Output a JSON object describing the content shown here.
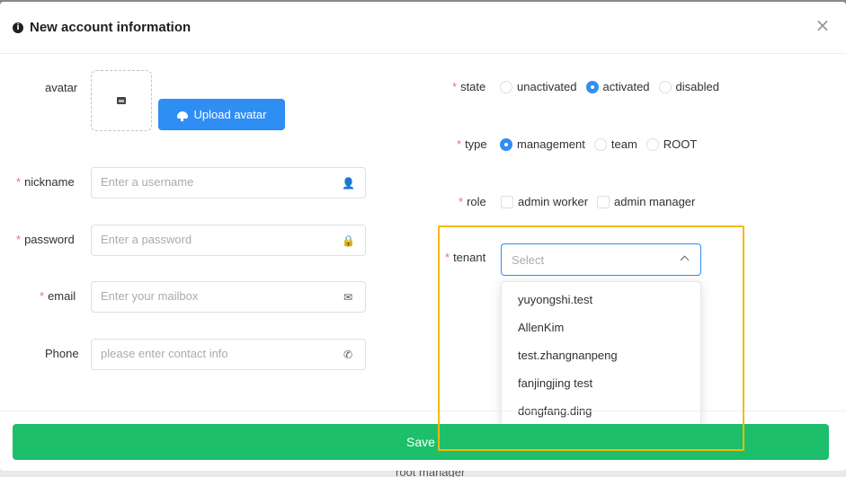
{
  "modal": {
    "title": "New account information",
    "info_icon": "i",
    "close_icon": "×"
  },
  "avatar": {
    "label": "avatar",
    "upload_label": "Upload avatar"
  },
  "fields": {
    "nickname": {
      "label": "nickname",
      "placeholder": "Enter a username",
      "icon": "user-icon",
      "glyph": "👤",
      "required": "*"
    },
    "password": {
      "label": "password",
      "placeholder": "Enter a password",
      "icon": "lock-icon",
      "glyph": "🔒",
      "required": "*"
    },
    "email": {
      "label": "email",
      "placeholder": "Enter your mailbox",
      "icon": "mail-icon",
      "glyph": "✉",
      "required": "*"
    },
    "phone": {
      "label": "Phone",
      "placeholder": "please enter contact info",
      "icon": "phone-icon",
      "glyph": "✆"
    }
  },
  "state": {
    "label": "state",
    "required": "*",
    "options": [
      "unactivated",
      "activated",
      "disabled"
    ],
    "selected": "activated"
  },
  "type": {
    "label": "type",
    "required": "*",
    "options": [
      "management",
      "team",
      "ROOT"
    ],
    "selected": "management"
  },
  "role": {
    "label": "role",
    "required": "*",
    "options": [
      "admin worker",
      "admin manager"
    ]
  },
  "tenant": {
    "label": "tenant",
    "required": "*",
    "placeholder": "Select",
    "options": [
      "yuyongshi.test",
      "AllenKim",
      "test.zhangnanpeng",
      "fanjingjing test",
      "dongfang.ding"
    ]
  },
  "footer": {
    "save_label": "Save"
  },
  "background_peek": {
    "text": "root manager"
  },
  "colors": {
    "primary": "#2f8ef4",
    "save": "#1dbf6b",
    "required": "#f56c6c",
    "highlight": "#f5b900"
  }
}
